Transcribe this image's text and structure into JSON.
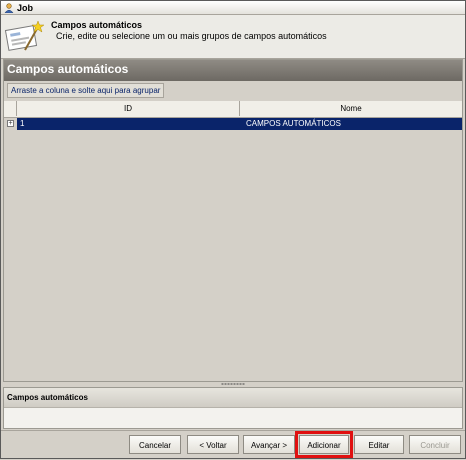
{
  "window": {
    "title": "Job"
  },
  "header": {
    "title": "Campos automáticos",
    "subtitle": "Crie, edite ou selecione um ou mais grupos de campos automáticos"
  },
  "panel": {
    "title": "Campos automáticos",
    "group_hint": "Arraste a coluna e solte aqui para agrupar"
  },
  "grid": {
    "columns": [
      "ID",
      "Nome"
    ],
    "rows": [
      {
        "expander": "+",
        "id": "1",
        "nome": "CAMPOS AUTOMÁTICOS"
      }
    ]
  },
  "lower_panel": {
    "title": "Campos automáticos"
  },
  "footer": {
    "buttons": {
      "cancel": "Cancelar",
      "back": "< Voltar",
      "next": "Avançar >",
      "add": "Adicionar",
      "edit": "Editar",
      "finish": "Concluir"
    }
  },
  "colors": {
    "selection": "#0a246a",
    "panel_header": "#7a766f",
    "highlight": "#e01010"
  }
}
